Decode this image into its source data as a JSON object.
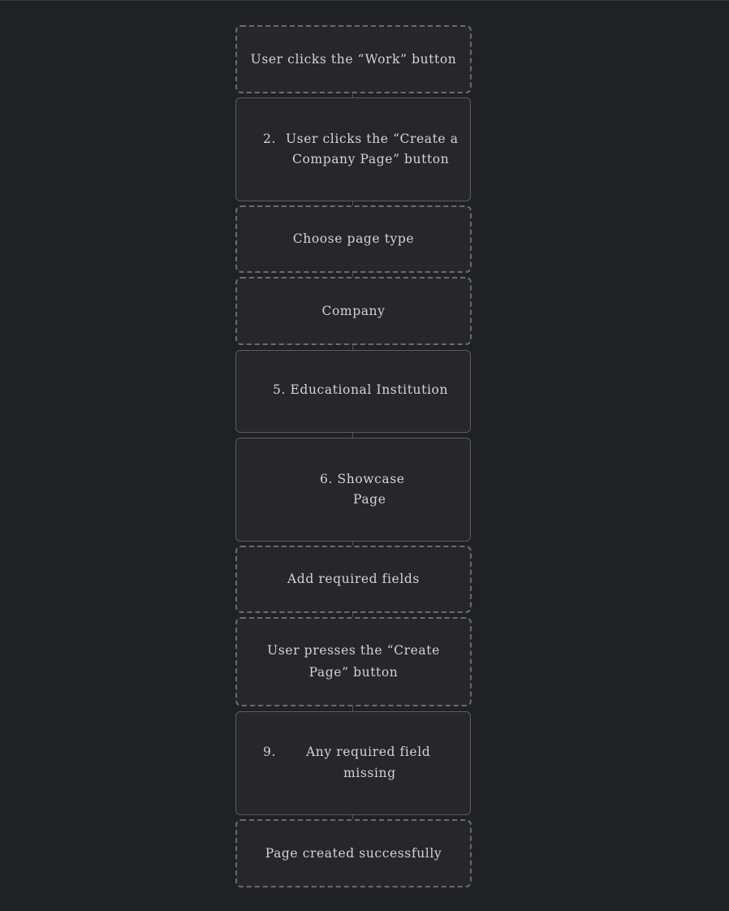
{
  "flow": {
    "step1": "User clicks the “Work” button",
    "step2": {
      "num": "2.",
      "line1": "User clicks the “Create a",
      "line2": "Company Page” button"
    },
    "step3": "Choose page type",
    "step4": "Company",
    "step5": "5. Educational Institution",
    "step6": {
      "line1": "6. Showcase",
      "line2": "Page"
    },
    "step7": "Add required fields",
    "step8": "User presses the “Create Page” button",
    "step9": {
      "num": "9.",
      "line1": "Any required field",
      "line2": "missing"
    },
    "step10": "Page created successfully"
  }
}
